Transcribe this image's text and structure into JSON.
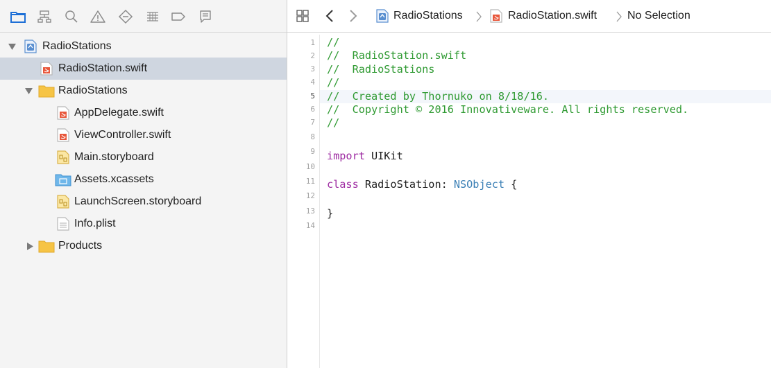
{
  "navigator": {
    "toolbar_icons": [
      "folder-icon",
      "hierarchy-icon",
      "search-icon",
      "warning-icon",
      "diamond-icon",
      "tests-icon",
      "breakpoint-icon",
      "report-icon"
    ],
    "tree": [
      {
        "label": "RadioStations",
        "kind": "project",
        "depth": 0,
        "disclosure": "expanded",
        "selected": false
      },
      {
        "label": "RadioStation.swift",
        "kind": "swift",
        "depth": 1,
        "disclosure": "none",
        "selected": true
      },
      {
        "label": "RadioStations",
        "kind": "folder",
        "depth": 0,
        "disclosure": "expanded",
        "selected": false
      },
      {
        "label": "AppDelegate.swift",
        "kind": "swift",
        "depth": 1,
        "disclosure": "none",
        "selected": false
      },
      {
        "label": "ViewController.swift",
        "kind": "swift",
        "depth": 1,
        "disclosure": "none",
        "selected": false
      },
      {
        "label": "Main.storyboard",
        "kind": "storyboard",
        "depth": 1,
        "disclosure": "none",
        "selected": false
      },
      {
        "label": "Assets.xcassets",
        "kind": "assets",
        "depth": 1,
        "disclosure": "none",
        "selected": false
      },
      {
        "label": "LaunchScreen.storyboard",
        "kind": "storyboard",
        "depth": 1,
        "disclosure": "none",
        "selected": false
      },
      {
        "label": "Info.plist",
        "kind": "plist",
        "depth": 1,
        "disclosure": "none",
        "selected": false
      },
      {
        "label": "Products",
        "kind": "folder",
        "depth": 0,
        "disclosure": "collapsed",
        "selected": false
      }
    ]
  },
  "editor": {
    "jump_bar": {
      "project": "RadioStations",
      "file": "RadioStation.swift",
      "selection": "No Selection"
    },
    "current_line": 5,
    "lines": [
      {
        "n": "1",
        "tokens": [
          {
            "t": "//",
            "c": "comment"
          }
        ]
      },
      {
        "n": "2",
        "tokens": [
          {
            "t": "//  RadioStation.swift",
            "c": "comment"
          }
        ]
      },
      {
        "n": "3",
        "tokens": [
          {
            "t": "//  RadioStations",
            "c": "comment"
          }
        ]
      },
      {
        "n": "4",
        "tokens": [
          {
            "t": "//",
            "c": "comment"
          }
        ]
      },
      {
        "n": "5",
        "tokens": [
          {
            "t": "//  Created by Thornuko on 8/18/16.",
            "c": "comment"
          }
        ]
      },
      {
        "n": "6",
        "tokens": [
          {
            "t": "//  Copyright © 2016 Innovativeware. All rights reserved.",
            "c": "comment"
          }
        ]
      },
      {
        "n": "7",
        "tokens": [
          {
            "t": "//",
            "c": "comment"
          }
        ]
      },
      {
        "n": "8",
        "tokens": []
      },
      {
        "n": "9",
        "tokens": [
          {
            "t": "import",
            "c": "keyword"
          },
          {
            "t": " UIKit",
            "c": "plain"
          }
        ]
      },
      {
        "n": "10",
        "tokens": []
      },
      {
        "n": "11",
        "tokens": [
          {
            "t": "class",
            "c": "keyword"
          },
          {
            "t": " RadioStation: ",
            "c": "plain"
          },
          {
            "t": "NSObject",
            "c": "type"
          },
          {
            "t": " {",
            "c": "plain"
          }
        ]
      },
      {
        "n": "12",
        "tokens": []
      },
      {
        "n": "13",
        "tokens": [
          {
            "t": "}",
            "c": "plain"
          }
        ]
      },
      {
        "n": "14",
        "tokens": []
      }
    ]
  },
  "colors": {
    "selection": "#cfd6e0",
    "folder": "#f6c445",
    "swift": "#e8573b",
    "comment": "#2f9a32",
    "keyword": "#9d2aa1",
    "type": "#3a7fb5",
    "accent": "#1d6fd6"
  }
}
